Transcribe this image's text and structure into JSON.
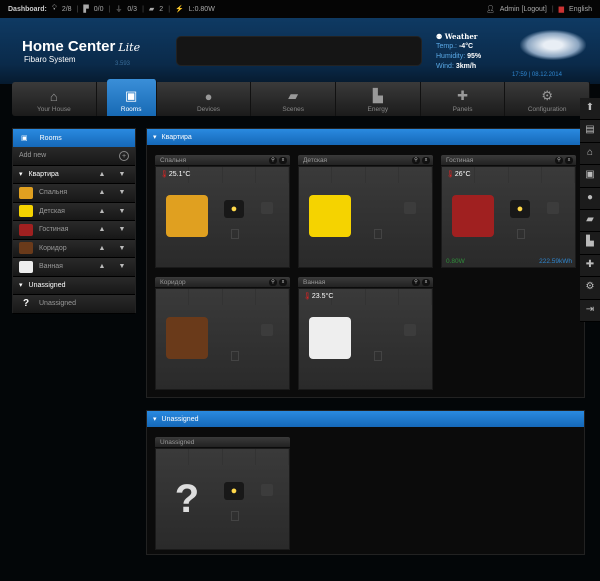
{
  "topbar": {
    "dashboard_label": "Dashboard:",
    "lights": "2/8",
    "blinds": "0/0",
    "sockets": "0/3",
    "scenes": "2",
    "power": "L:0.80W",
    "user": "Admin [Logout]",
    "language": "English"
  },
  "header": {
    "title": "Home Center",
    "title_suffix": "Lite",
    "subtitle": "Fibaro System",
    "version": "3.593",
    "weather": {
      "title": "Weather",
      "temp_label": "Temp.:",
      "temp": "-4°C",
      "humidity_label": "Humidity:",
      "humidity": "95%",
      "wind_label": "Wind:",
      "wind": "3km/h"
    },
    "datetime": "17:59 | 08.12.2014"
  },
  "nav": [
    {
      "label": "Your House",
      "icon": "⌂"
    },
    {
      "label": "Rooms",
      "icon": "▣"
    },
    {
      "label": "Devices",
      "icon": "●"
    },
    {
      "label": "Scenes",
      "icon": "▰"
    },
    {
      "label": "Energy",
      "icon": "▙"
    },
    {
      "label": "Panels",
      "icon": "✚"
    },
    {
      "label": "Configuration",
      "icon": "⚙"
    }
  ],
  "sidebar": {
    "title": "Rooms",
    "add_new": "Add new",
    "groups": [
      {
        "name": "Квартира",
        "rooms": [
          {
            "name": "Спальня",
            "color": "#e0a020"
          },
          {
            "name": "Детская",
            "color": "#f5d300"
          },
          {
            "name": "Гостиная",
            "color": "#a02020"
          },
          {
            "name": "Коридор",
            "color": "#6a3a1a"
          },
          {
            "name": "Ванная",
            "color": "#eeeeee"
          }
        ]
      },
      {
        "name": "Unassigned",
        "rooms": [
          {
            "name": "Unassigned",
            "icon": "?"
          }
        ]
      }
    ]
  },
  "sections": [
    {
      "title": "Квартира",
      "rooms": [
        {
          "name": "Спальня",
          "temp": "25.1°C",
          "color": "#e0a020",
          "bulb": true
        },
        {
          "name": "Детская",
          "color": "#f5d300"
        },
        {
          "name": "Гостиная",
          "temp": "26°C",
          "color": "#a02020",
          "bulb": true,
          "power": "0.80W",
          "energy": "222.59kWh"
        },
        {
          "name": "Коридор",
          "color": "#6a3a1a"
        },
        {
          "name": "Ванная",
          "temp": "23.5°C",
          "color": "#eeeeee"
        }
      ]
    },
    {
      "title": "Unassigned",
      "rooms": [
        {
          "name": "Unassigned",
          "color": "#bbbbbb",
          "bulb": true
        }
      ]
    }
  ]
}
